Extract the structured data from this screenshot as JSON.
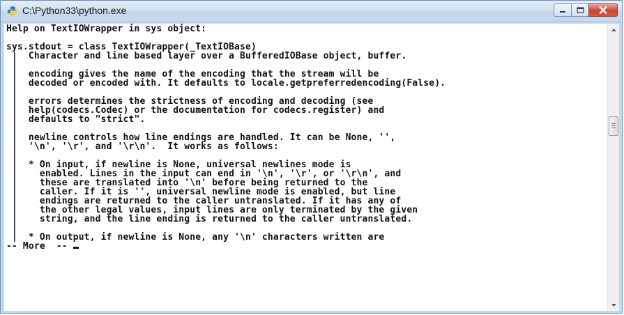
{
  "window": {
    "title": "C:\\Python33\\python.exe",
    "colors": {
      "titlebar": "#c8daee",
      "close_button": "#c9462f",
      "console_background": "#ffffff",
      "console_text": "#111111"
    },
    "caption_buttons": {
      "minimize": "minimize-icon",
      "maximize": "maximize-icon",
      "close": "close-icon"
    }
  },
  "console": {
    "lines": [
      "Help on TextIOWrapper in sys object:",
      "",
      "sys.stdout = class TextIOWrapper(_TextIOBase)",
      " |  Character and line based layer over a BufferedIOBase object, buffer.",
      " |",
      " |  encoding gives the name of the encoding that the stream will be",
      " |  decoded or encoded with. It defaults to locale.getpreferredencoding(False).",
      " |",
      " |  errors determines the strictness of encoding and decoding (see",
      " |  help(codecs.Codec) or the documentation for codecs.register) and",
      " |  defaults to \"strict\".",
      " |",
      " |  newline controls how line endings are handled. It can be None, '',",
      " |  '\\n', '\\r', and '\\r\\n'.  It works as follows:",
      " |",
      " |  * On input, if newline is None, universal newlines mode is",
      " |    enabled. Lines in the input can end in '\\n', '\\r', or '\\r\\n', and",
      " |    these are translated into '\\n' before being returned to the",
      " |    caller. If it is '', universal newline mode is enabled, but line",
      " |    endings are returned to the caller untranslated. If it has any of",
      " |    the other legal values, input lines are only terminated by the given",
      " |    string, and the line ending is returned to the caller untranslated.",
      " |",
      " |  * On output, if newline is None, any '\\n' characters written are"
    ],
    "more_prompt": "-- More  -- "
  },
  "scrollbar": {
    "up_arrow": "scroll-up-arrow-icon",
    "down_arrow": "scroll-down-arrow-icon",
    "position": 0.33
  }
}
